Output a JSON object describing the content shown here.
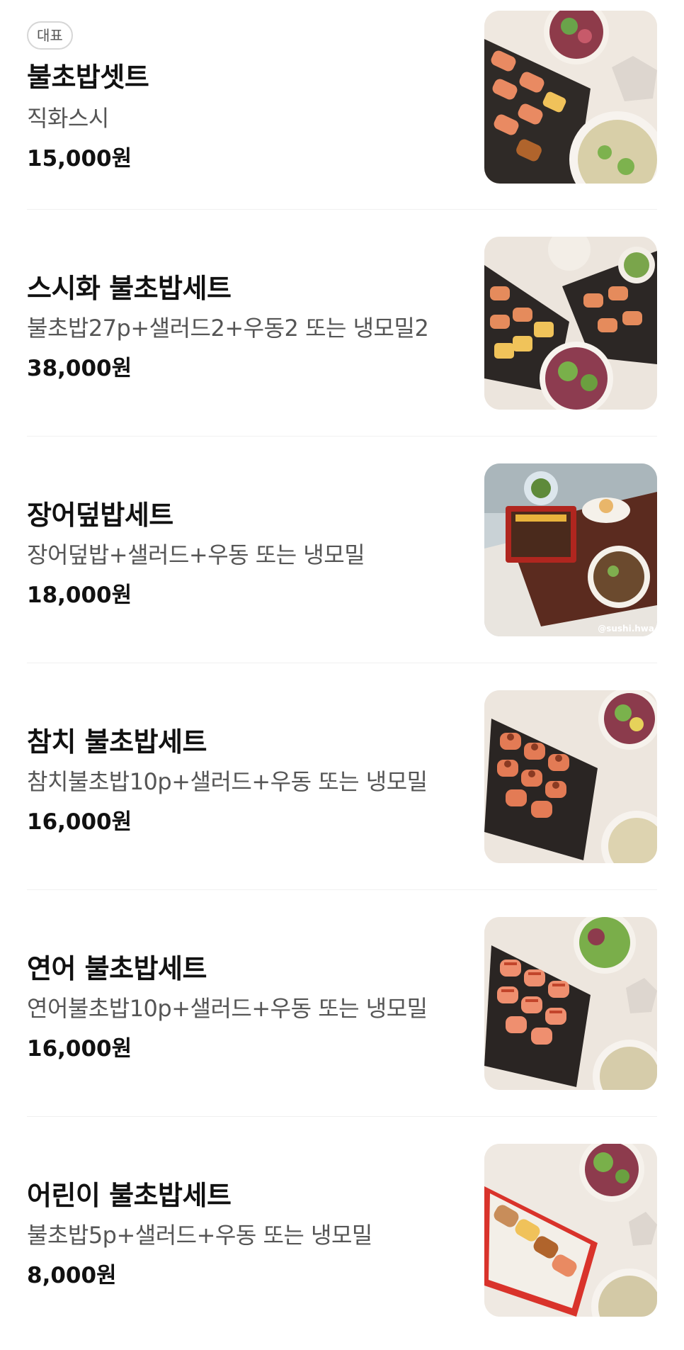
{
  "menu": {
    "items": [
      {
        "badge": "대표",
        "name": "불초밥셋트",
        "description": "직화스시",
        "price": "15,000원",
        "image": "sushi-set-photo"
      },
      {
        "name": "스시화 불초밥세트",
        "description": "불초밥27p+샐러드2+우동2 또는 냉모밀2",
        "price": "38,000원",
        "image": "large-sushi-set-photo"
      },
      {
        "name": "장어덮밥세트",
        "description": "장어덮밥+샐러드+우동 또는 냉모밀",
        "price": "18,000원",
        "image": "eel-rice-bowl-photo",
        "watermark": "@sushi.hwa"
      },
      {
        "name": "참치 불초밥세트",
        "description": "참치불초밥10p+샐러드+우동 또는 냉모밀",
        "price": "16,000원",
        "image": "tuna-sushi-photo"
      },
      {
        "name": "연어 불초밥세트",
        "description": "연어불초밥10p+샐러드+우동 또는 냉모밀",
        "price": "16,000원",
        "image": "salmon-sushi-photo"
      },
      {
        "name": "어린이 불초밥세트",
        "description": "불초밥5p+샐러드+우동 또는 냉모밀",
        "price": "8,000원",
        "image": "kids-sushi-photo"
      }
    ]
  }
}
